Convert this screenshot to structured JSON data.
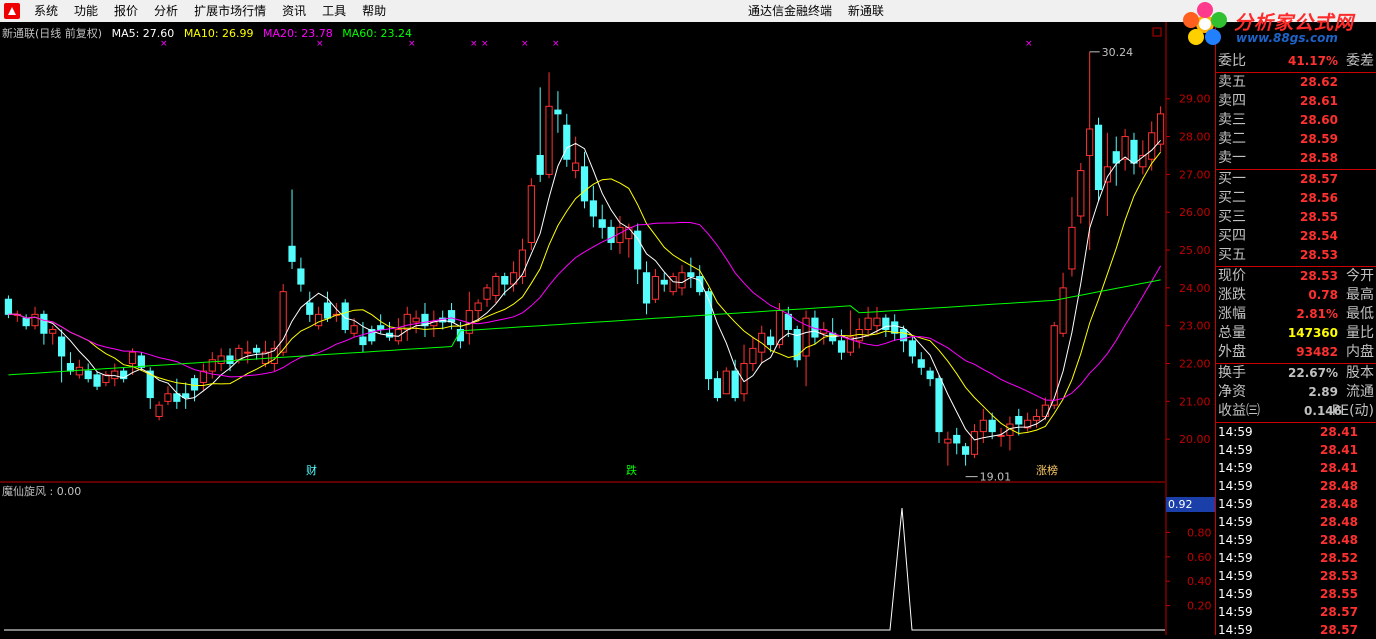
{
  "menu": [
    "系统",
    "功能",
    "报价",
    "分析",
    "扩展市场行情",
    "资讯",
    "工具",
    "帮助"
  ],
  "title": {
    "terminal": "通达信金融终端",
    "stock": "新通联"
  },
  "watermark": {
    "brand": "分析家公式网",
    "url": "www.88gs.com"
  },
  "legend": {
    "name": "新通联(日线 前复权)",
    "ma5": "MA5: 27.60",
    "ma10": "MA10: 26.99",
    "ma20": "MA20: 23.78",
    "ma60": "MA60: 23.24"
  },
  "colors": {
    "up": "#ff3232",
    "down": "#54fcfc",
    "ma5": "#ffffff",
    "ma10": "#ffff00",
    "ma20": "#ff00ff",
    "ma60": "#00ff00",
    "axis": "#c00000"
  },
  "price_axis": {
    "ticks": [
      "29.00",
      "28.00",
      "27.00",
      "26.00",
      "25.00",
      "24.00",
      "23.00",
      "22.00",
      "21.00",
      "20.00"
    ]
  },
  "annotations": {
    "high": "30.24",
    "low": "19.01",
    "event1": "财",
    "event2": "跌",
    "event3": "涨榜"
  },
  "indicator": {
    "label": "魔仙旋风 : 0.00",
    "value_box": "0.92",
    "ticks": [
      "0.80",
      "0.60",
      "0.40",
      "0.20"
    ]
  },
  "chart_data": {
    "type": "candlestick",
    "ylim": [
      19.0,
      30.5
    ],
    "candles": [
      [
        23.7,
        23.3,
        23.8,
        23.2
      ],
      [
        23.3,
        23.3,
        23.4,
        23.1
      ],
      [
        23.2,
        23.0,
        23.3,
        22.9
      ],
      [
        23.0,
        23.3,
        23.5,
        22.9
      ],
      [
        23.3,
        22.8,
        23.4,
        22.5
      ],
      [
        22.8,
        22.9,
        23.0,
        22.5
      ],
      [
        22.7,
        22.2,
        22.9,
        21.5
      ],
      [
        22.0,
        21.8,
        22.3,
        21.7
      ],
      [
        21.7,
        21.9,
        22.1,
        21.6
      ],
      [
        21.8,
        21.6,
        22.0,
        21.5
      ],
      [
        21.7,
        21.4,
        21.8,
        21.3
      ],
      [
        21.5,
        21.7,
        21.8,
        21.4
      ],
      [
        21.6,
        21.8,
        22.0,
        21.4
      ],
      [
        21.8,
        21.6,
        21.9,
        21.5
      ],
      [
        22.0,
        22.3,
        22.4,
        21.7
      ],
      [
        22.2,
        21.9,
        22.3,
        21.8
      ],
      [
        21.8,
        21.1,
        21.9,
        20.8
      ],
      [
        20.6,
        20.9,
        21.0,
        20.5
      ],
      [
        21.0,
        21.2,
        21.4,
        20.9
      ],
      [
        21.2,
        21.0,
        21.6,
        20.8
      ],
      [
        21.2,
        21.1,
        21.5,
        20.8
      ],
      [
        21.6,
        21.3,
        21.7,
        21.0
      ],
      [
        21.5,
        21.8,
        22.0,
        21.3
      ],
      [
        21.8,
        22.1,
        22.3,
        21.6
      ],
      [
        22.0,
        22.2,
        22.4,
        21.8
      ],
      [
        22.2,
        22.0,
        22.4,
        21.8
      ],
      [
        22.1,
        22.4,
        22.5,
        22.0
      ],
      [
        22.3,
        22.3,
        22.6,
        22.0
      ],
      [
        22.4,
        22.3,
        22.5,
        22.1
      ],
      [
        22.0,
        22.3,
        22.6,
        21.9
      ],
      [
        22.0,
        22.4,
        22.6,
        21.8
      ],
      [
        22.3,
        23.9,
        24.1,
        22.2
      ],
      [
        25.1,
        24.7,
        26.6,
        24.5
      ],
      [
        24.5,
        24.1,
        24.8,
        23.9
      ],
      [
        23.6,
        23.3,
        23.9,
        23.1
      ],
      [
        23.0,
        23.3,
        23.5,
        22.9
      ],
      [
        23.6,
        23.2,
        23.9,
        23.1
      ],
      [
        23.3,
        23.3,
        23.6,
        23.1
      ],
      [
        23.6,
        22.9,
        23.7,
        22.8
      ],
      [
        22.8,
        23.0,
        23.2,
        22.7
      ],
      [
        22.7,
        22.5,
        23.1,
        22.3
      ],
      [
        22.9,
        22.6,
        23.0,
        22.5
      ],
      [
        23.0,
        22.9,
        23.3,
        22.8
      ],
      [
        22.8,
        22.7,
        23.1,
        22.6
      ],
      [
        22.6,
        22.9,
        23.2,
        22.5
      ],
      [
        22.9,
        23.3,
        23.5,
        22.6
      ],
      [
        23.1,
        23.2,
        23.4,
        22.8
      ],
      [
        23.3,
        23.0,
        23.6,
        22.7
      ],
      [
        23.0,
        23.1,
        23.4,
        22.7
      ],
      [
        23.2,
        23.1,
        23.4,
        22.9
      ],
      [
        23.4,
        23.1,
        23.6,
        22.9
      ],
      [
        22.9,
        22.6,
        23.1,
        22.4
      ],
      [
        22.8,
        23.4,
        23.9,
        22.5
      ],
      [
        23.4,
        23.6,
        23.7,
        23.1
      ],
      [
        23.7,
        24.0,
        24.1,
        23.5
      ],
      [
        23.8,
        24.3,
        24.4,
        23.6
      ],
      [
        24.3,
        24.1,
        24.4,
        23.8
      ],
      [
        24.1,
        24.4,
        24.7,
        23.9
      ],
      [
        24.3,
        25.0,
        25.3,
        24.1
      ],
      [
        25.2,
        26.7,
        26.9,
        25.0
      ],
      [
        27.5,
        27.0,
        29.3,
        26.8
      ],
      [
        27.0,
        28.8,
        29.7,
        26.9
      ],
      [
        28.7,
        28.6,
        29.2,
        28.1
      ],
      [
        28.3,
        27.4,
        28.6,
        27.2
      ],
      [
        27.1,
        27.3,
        28.0,
        26.9
      ],
      [
        27.2,
        26.3,
        27.6,
        26.1
      ],
      [
        26.3,
        25.9,
        26.7,
        25.6
      ],
      [
        25.8,
        25.6,
        26.2,
        25.3
      ],
      [
        25.6,
        25.2,
        25.8,
        25.0
      ],
      [
        25.2,
        25.6,
        25.9,
        24.9
      ],
      [
        25.3,
        25.6,
        25.7,
        24.8
      ],
      [
        25.5,
        24.5,
        25.7,
        24.1
      ],
      [
        24.4,
        23.6,
        24.7,
        23.3
      ],
      [
        23.7,
        24.3,
        24.5,
        23.6
      ],
      [
        24.2,
        24.1,
        24.4,
        23.9
      ],
      [
        23.9,
        24.3,
        24.4,
        23.8
      ],
      [
        24.0,
        24.4,
        24.6,
        23.8
      ],
      [
        24.4,
        24.3,
        24.8,
        24.0
      ],
      [
        24.3,
        23.9,
        24.6,
        23.8
      ],
      [
        23.9,
        21.6,
        24.0,
        21.3
      ],
      [
        21.6,
        21.1,
        21.8,
        21.0
      ],
      [
        21.2,
        21.8,
        21.9,
        21.2
      ],
      [
        21.8,
        21.1,
        22.1,
        21.0
      ],
      [
        21.2,
        22.0,
        22.5,
        21.0
      ],
      [
        22.0,
        22.4,
        22.7,
        21.8
      ],
      [
        22.3,
        22.8,
        23.0,
        22.0
      ],
      [
        22.7,
        22.5,
        22.9,
        22.3
      ],
      [
        22.5,
        23.4,
        23.6,
        22.4
      ],
      [
        23.3,
        22.9,
        23.5,
        22.7
      ],
      [
        22.9,
        22.1,
        23.0,
        21.9
      ],
      [
        22.2,
        23.2,
        23.4,
        21.4
      ],
      [
        23.2,
        22.7,
        23.4,
        22.5
      ],
      [
        22.8,
        22.9,
        23.1,
        22.5
      ],
      [
        22.8,
        22.6,
        23.2,
        22.5
      ],
      [
        22.6,
        22.3,
        22.9,
        22.1
      ],
      [
        22.3,
        22.7,
        23.4,
        22.2
      ],
      [
        22.6,
        22.9,
        23.2,
        22.4
      ],
      [
        22.9,
        23.2,
        23.5,
        22.7
      ],
      [
        23.0,
        23.2,
        23.5,
        22.8
      ],
      [
        23.2,
        22.9,
        23.3,
        22.7
      ],
      [
        23.1,
        22.8,
        23.3,
        22.6
      ],
      [
        22.9,
        22.6,
        23.0,
        22.3
      ],
      [
        22.6,
        22.2,
        22.7,
        22.0
      ],
      [
        22.1,
        21.9,
        22.3,
        21.7
      ],
      [
        21.8,
        21.6,
        21.9,
        21.4
      ],
      [
        21.6,
        20.2,
        21.7,
        19.9
      ],
      [
        19.9,
        20.0,
        20.2,
        19.3
      ],
      [
        20.1,
        19.9,
        20.3,
        19.6
      ],
      [
        19.8,
        19.6,
        19.9,
        19.3
      ],
      [
        19.6,
        20.2,
        20.4,
        19.5
      ],
      [
        20.2,
        20.5,
        20.8,
        19.9
      ],
      [
        20.5,
        20.2,
        20.7,
        20.0
      ],
      [
        20.1,
        20.1,
        20.3,
        19.8
      ],
      [
        20.1,
        20.4,
        20.6,
        19.7
      ],
      [
        20.6,
        20.4,
        20.8,
        20.1
      ],
      [
        20.3,
        20.5,
        20.7,
        20.2
      ],
      [
        20.5,
        20.6,
        20.8,
        20.3
      ],
      [
        20.6,
        20.9,
        21.1,
        20.5
      ],
      [
        20.9,
        23.0,
        23.1,
        20.8
      ],
      [
        22.8,
        24.0,
        24.4,
        22.7
      ],
      [
        24.5,
        25.6,
        26.4,
        24.3
      ],
      [
        25.9,
        27.1,
        27.3,
        25.7
      ],
      [
        27.5,
        28.2,
        30.24,
        25.0
      ],
      [
        28.3,
        26.6,
        28.5,
        26.3
      ],
      [
        26.8,
        27.2,
        28.1,
        25.9
      ],
      [
        27.6,
        27.3,
        28.0,
        26.7
      ],
      [
        27.4,
        28.0,
        28.2,
        27.1
      ],
      [
        27.9,
        27.3,
        28.1,
        27.0
      ],
      [
        27.2,
        27.5,
        27.9,
        27.0
      ],
      [
        27.4,
        28.1,
        28.4,
        27.1
      ],
      [
        27.8,
        28.6,
        28.8,
        27.6
      ]
    ],
    "ma60_anchor": "slow green"
  }
}
